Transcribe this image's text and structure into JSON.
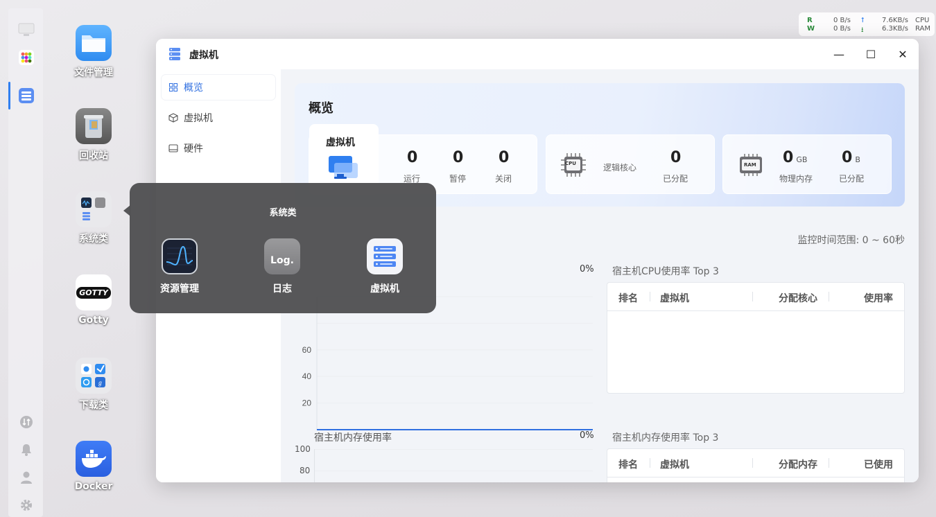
{
  "desktop": {
    "icons": [
      {
        "label": "文件管理"
      },
      {
        "label": "回收站"
      },
      {
        "label": "系统类"
      },
      {
        "label": "Gotty"
      },
      {
        "label": "下载类"
      },
      {
        "label": "Docker"
      }
    ],
    "gotty_logo_text": "GOTTY"
  },
  "net_widget": {
    "r_label": "R",
    "w_label": "W",
    "read_rate": "0  B/s",
    "write_rate": "0  B/s",
    "up_rate": "7.6KB/s",
    "down_rate": "6.3KB/s",
    "cpu_label": "CPU",
    "ram_label": "RAM",
    "accent_r": "#2a8a3a",
    "accent_w": "#2a8a3a"
  },
  "window": {
    "title": "虚拟机",
    "controls": {
      "minimize": "—",
      "maximize": "☐",
      "close": "✕"
    }
  },
  "sidebar": {
    "items": [
      {
        "label": "概览",
        "active": true
      },
      {
        "label": "虚拟机",
        "active": false
      },
      {
        "label": "硬件",
        "active": false
      }
    ]
  },
  "overview": {
    "title": "概览",
    "vm_card": {
      "title": "虚拟机",
      "stats": [
        {
          "value": "0",
          "label": "运行"
        },
        {
          "value": "0",
          "label": "暂停"
        },
        {
          "value": "0",
          "label": "关闭"
        }
      ]
    },
    "cpu_card": {
      "chip_text": "CPU",
      "label": "逻辑核心",
      "value": "0",
      "value_label": "已分配"
    },
    "ram_card": {
      "chip_text": "RAM",
      "phys_value": "0",
      "phys_unit": "GB",
      "phys_label": "物理内存",
      "alloc_value": "0",
      "alloc_unit": "B",
      "alloc_label": "已分配"
    }
  },
  "monitor_range": "监控时间范围: 0 ~ 60秒",
  "cpu_chart": {
    "percent": "0%",
    "yticks": [
      "60",
      "40",
      "20"
    ]
  },
  "cpu_top3": {
    "title": "宿主机CPU使用率 Top 3",
    "columns": [
      "排名",
      "虚拟机",
      "分配核心",
      "使用率"
    ]
  },
  "mem_chart": {
    "title": "宿主机内存使用率",
    "percent": "0%",
    "yticks": [
      "100",
      "80"
    ]
  },
  "mem_top3": {
    "title": "宿主机内存使用率 Top 3",
    "columns": [
      "排名",
      "虚拟机",
      "分配内存",
      "已使用"
    ]
  },
  "popup": {
    "title": "系统类",
    "apps": [
      {
        "label": "资源管理"
      },
      {
        "label": "日志",
        "tile_text": "Log."
      },
      {
        "label": "虚拟机"
      }
    ]
  },
  "chart_data": {
    "type": "line",
    "series": [
      {
        "values": [
          0,
          0
        ]
      }
    ],
    "x": [
      0,
      60
    ],
    "ylim": [
      0,
      100
    ],
    "grid": true
  }
}
